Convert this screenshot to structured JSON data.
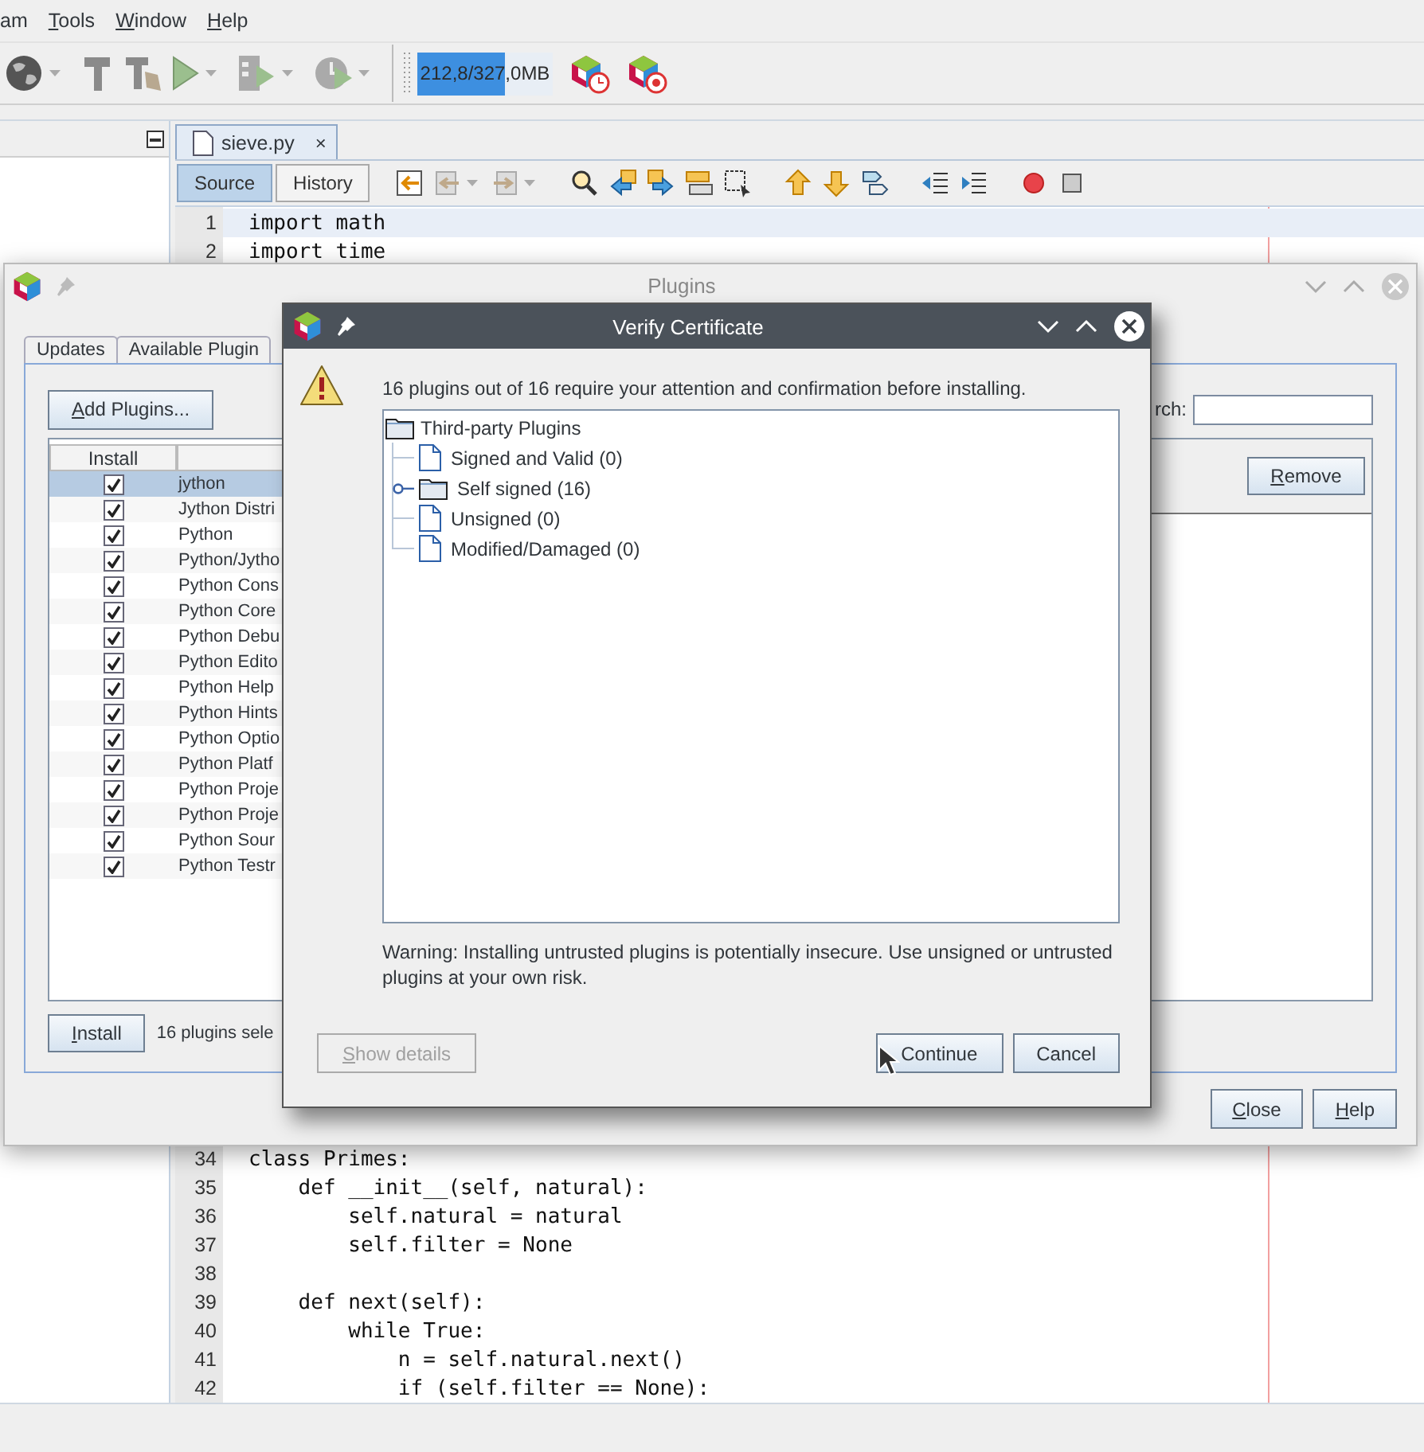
{
  "menu_bar": {
    "items": [
      {
        "label": "am",
        "mnemonic": false
      },
      {
        "label": "Tools",
        "mnemonic": true
      },
      {
        "label": "Window",
        "mnemonic": true
      },
      {
        "label": "Help",
        "mnemonic": true
      }
    ]
  },
  "toolbar": {
    "memory": {
      "reading": "212,8/327,0MB",
      "level": 0.65
    }
  },
  "editor": {
    "tabs": [
      {
        "label": "sieve.py",
        "close": "×",
        "selected": true
      }
    ],
    "views": [
      {
        "label": "Source",
        "selected": true
      },
      {
        "label": "History",
        "selected": false
      }
    ],
    "top_lines": [
      {
        "number": "1",
        "code": "import math",
        "current": true
      },
      {
        "number": "2",
        "code": "import time",
        "current": false
      }
    ],
    "bottom_lines": [
      {
        "number": "34",
        "code": "class Primes:",
        "current": false
      },
      {
        "number": "35",
        "code": "    def __init__(self, natural):",
        "current": false
      },
      {
        "number": "36",
        "code": "        self.natural = natural",
        "current": false
      },
      {
        "number": "37",
        "code": "        self.filter = None",
        "current": false
      },
      {
        "number": "38",
        "current": false
      },
      {
        "number": "39",
        "code": "    def next(self):",
        "current": false
      },
      {
        "number": "40",
        "code": "        while True:",
        "current": false
      },
      {
        "number": "41",
        "code": "            n = self.natural.next()",
        "current": false
      },
      {
        "number": "42",
        "code": "            if (self.filter == None):",
        "current": false
      }
    ]
  },
  "plugins_window": {
    "title": "Plugins",
    "tabs": [
      {
        "label": "Updates",
        "selected": false
      },
      {
        "label": "Available Plugin",
        "selected": false
      }
    ],
    "add_button": {
      "label": "Add Plugins...",
      "mnemonic": true
    },
    "search_label": "rch:",
    "table": {
      "columns": [
        "Install"
      ],
      "rows": [
        {
          "name": "jython",
          "checked": true,
          "selected": true
        },
        {
          "name": "Jython Distri",
          "checked": true,
          "selected": false
        },
        {
          "name": "Python",
          "checked": true,
          "selected": false
        },
        {
          "name": "Python/Jytho",
          "checked": true,
          "selected": false
        },
        {
          "name": "Python Cons",
          "checked": true,
          "selected": false
        },
        {
          "name": "Python Core",
          "checked": true,
          "selected": false
        },
        {
          "name": "Python Debu",
          "checked": true,
          "selected": false
        },
        {
          "name": "Python Edito",
          "checked": true,
          "selected": false
        },
        {
          "name": "Python Help",
          "checked": true,
          "selected": false
        },
        {
          "name": "Python Hints",
          "checked": true,
          "selected": false
        },
        {
          "name": "Python Optio",
          "checked": true,
          "selected": false
        },
        {
          "name": "Python Platf",
          "checked": true,
          "selected": false
        },
        {
          "name": "Python Proje",
          "checked": true,
          "selected": false
        },
        {
          "name": "Python Proje",
          "checked": true,
          "selected": false
        },
        {
          "name": "Python Sour",
          "checked": true,
          "selected": false
        },
        {
          "name": "Python Testr",
          "checked": true,
          "selected": false
        }
      ]
    },
    "remove_button": {
      "label": "Remove",
      "mnemonic": true
    },
    "install_button": {
      "label": "Install",
      "mnemonic": true
    },
    "status": "16 plugins sele",
    "buttons": [
      {
        "label": "Close",
        "mnemonic": true
      },
      {
        "label": "Help",
        "mnemonic": true
      }
    ]
  },
  "dialog": {
    "title": "Verify Certificate",
    "message": "16 plugins out of 16 require your attention and confirmation before installing.",
    "tree": {
      "label": "Third-party Plugins",
      "kind": "folder",
      "children": [
        {
          "label": "Signed and Valid (0)",
          "kind": "file"
        },
        {
          "label": "Self signed (16)",
          "kind": "folder",
          "expanded": false
        },
        {
          "label": "Unsigned (0)",
          "kind": "file"
        },
        {
          "label": "Modified/Damaged (0)",
          "kind": "file"
        }
      ]
    },
    "warning": "Warning: Installing untrusted plugins is potentially insecure. Use unsigned or untrusted plugins at your own risk.",
    "buttons": [
      {
        "label": "Show details",
        "mnemonic": true,
        "disabled": true
      },
      {
        "label": "Continue",
        "mnemonic": false,
        "disabled": false
      },
      {
        "label": "Cancel",
        "mnemonic": false,
        "disabled": false
      }
    ]
  }
}
